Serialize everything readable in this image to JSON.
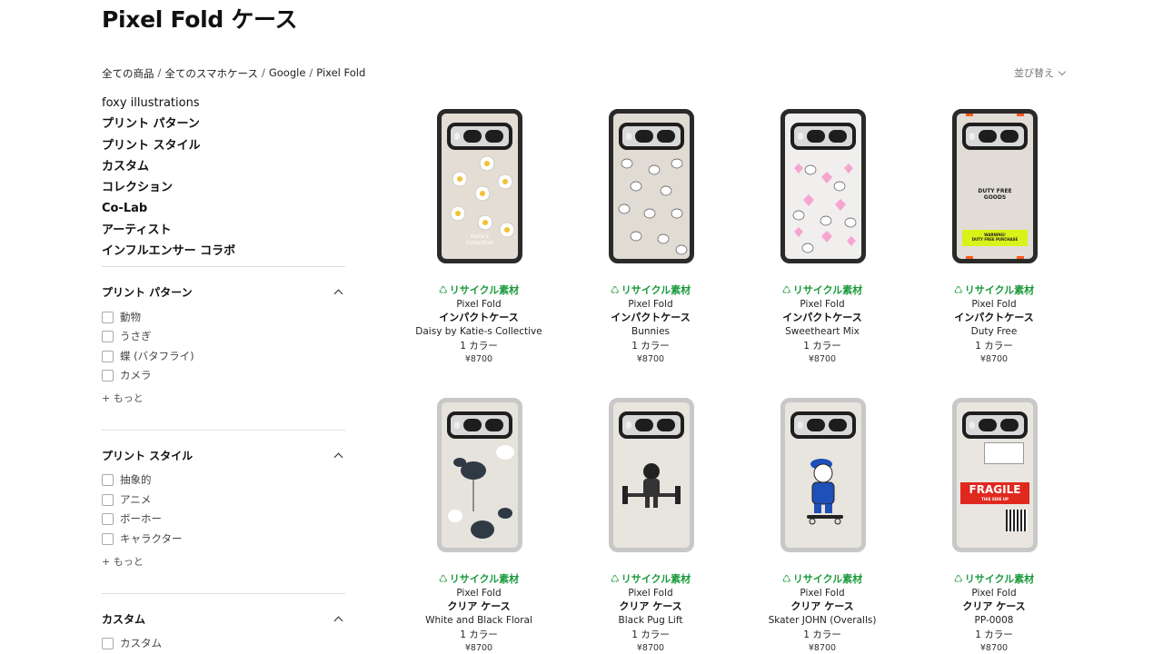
{
  "page": {
    "title": "Pixel Fold ケース"
  },
  "breadcrumb": [
    "全ての商品",
    "全てのスマホケース",
    "Google",
    "Pixel Fold"
  ],
  "sort": {
    "label": "並び替え"
  },
  "categories": [
    "foxy illustrations",
    "プリント パターン",
    "プリント スタイル",
    "カスタム",
    "コレクション",
    "Co-Lab",
    "アーティスト",
    "インフルエンサー コラボ"
  ],
  "filters": [
    {
      "title": "プリント パターン",
      "options": [
        "動物",
        "うさぎ",
        "蝶 (バタフライ)",
        "カメラ"
      ],
      "more": "+ もっと"
    },
    {
      "title": "プリント スタイル",
      "options": [
        "抽象的",
        "アニメ",
        "ボーホー",
        "キャラクター"
      ],
      "more": "+ もっと"
    },
    {
      "title": "カスタム",
      "options": [
        "カスタム"
      ]
    }
  ],
  "products": [
    {
      "badge": "リサイクル素材",
      "model": "Pixel Fold",
      "type": "インパクトケース",
      "name": "Daisy by Katie-s Collective",
      "colors": "1 カラー",
      "price": "¥8700",
      "print_text": [
        "Katie's",
        "Collective"
      ]
    },
    {
      "badge": "リサイクル素材",
      "model": "Pixel Fold",
      "type": "インパクトケース",
      "name": "Bunnies",
      "colors": "1 カラー",
      "price": "¥8700"
    },
    {
      "badge": "リサイクル素材",
      "model": "Pixel Fold",
      "type": "インパクトケース",
      "name": "Sweetheart Mix",
      "colors": "1 カラー",
      "price": "¥8700"
    },
    {
      "badge": "リサイクル素材",
      "model": "Pixel Fold",
      "type": "インパクトケース",
      "name": "Duty Free",
      "colors": "1 カラー",
      "price": "¥8700",
      "print_text": [
        "DUTY FREE",
        "GOODS",
        "WARNING!",
        "DUTY FREE PURCHASE"
      ]
    },
    {
      "badge": "リサイクル素材",
      "model": "Pixel Fold",
      "type": "クリア ケース",
      "name": "White and Black Floral",
      "colors": "1 カラー",
      "price": "¥8700"
    },
    {
      "badge": "リサイクル素材",
      "model": "Pixel Fold",
      "type": "クリア ケース",
      "name": "Black Pug Lift",
      "colors": "1 カラー",
      "price": "¥8700"
    },
    {
      "badge": "リサイクル素材",
      "model": "Pixel Fold",
      "type": "クリア ケース",
      "name": "Skater JOHN (Overalls)",
      "colors": "1 カラー",
      "price": "¥8700"
    },
    {
      "badge": "リサイクル素材",
      "model": "Pixel Fold",
      "type": "クリア ケース",
      "name": "PP-0008",
      "colors": "1 カラー",
      "price": "¥8700",
      "print_text": [
        "FRAGILE",
        "THIS SIDE UP"
      ]
    }
  ],
  "colors": {
    "recycled_green": "#1a9a3b",
    "divider": "#dddddd",
    "fragile_red": "#e0281e",
    "warning_yellow": "#d8f21a",
    "accent_orange": "#ff5a1f"
  }
}
